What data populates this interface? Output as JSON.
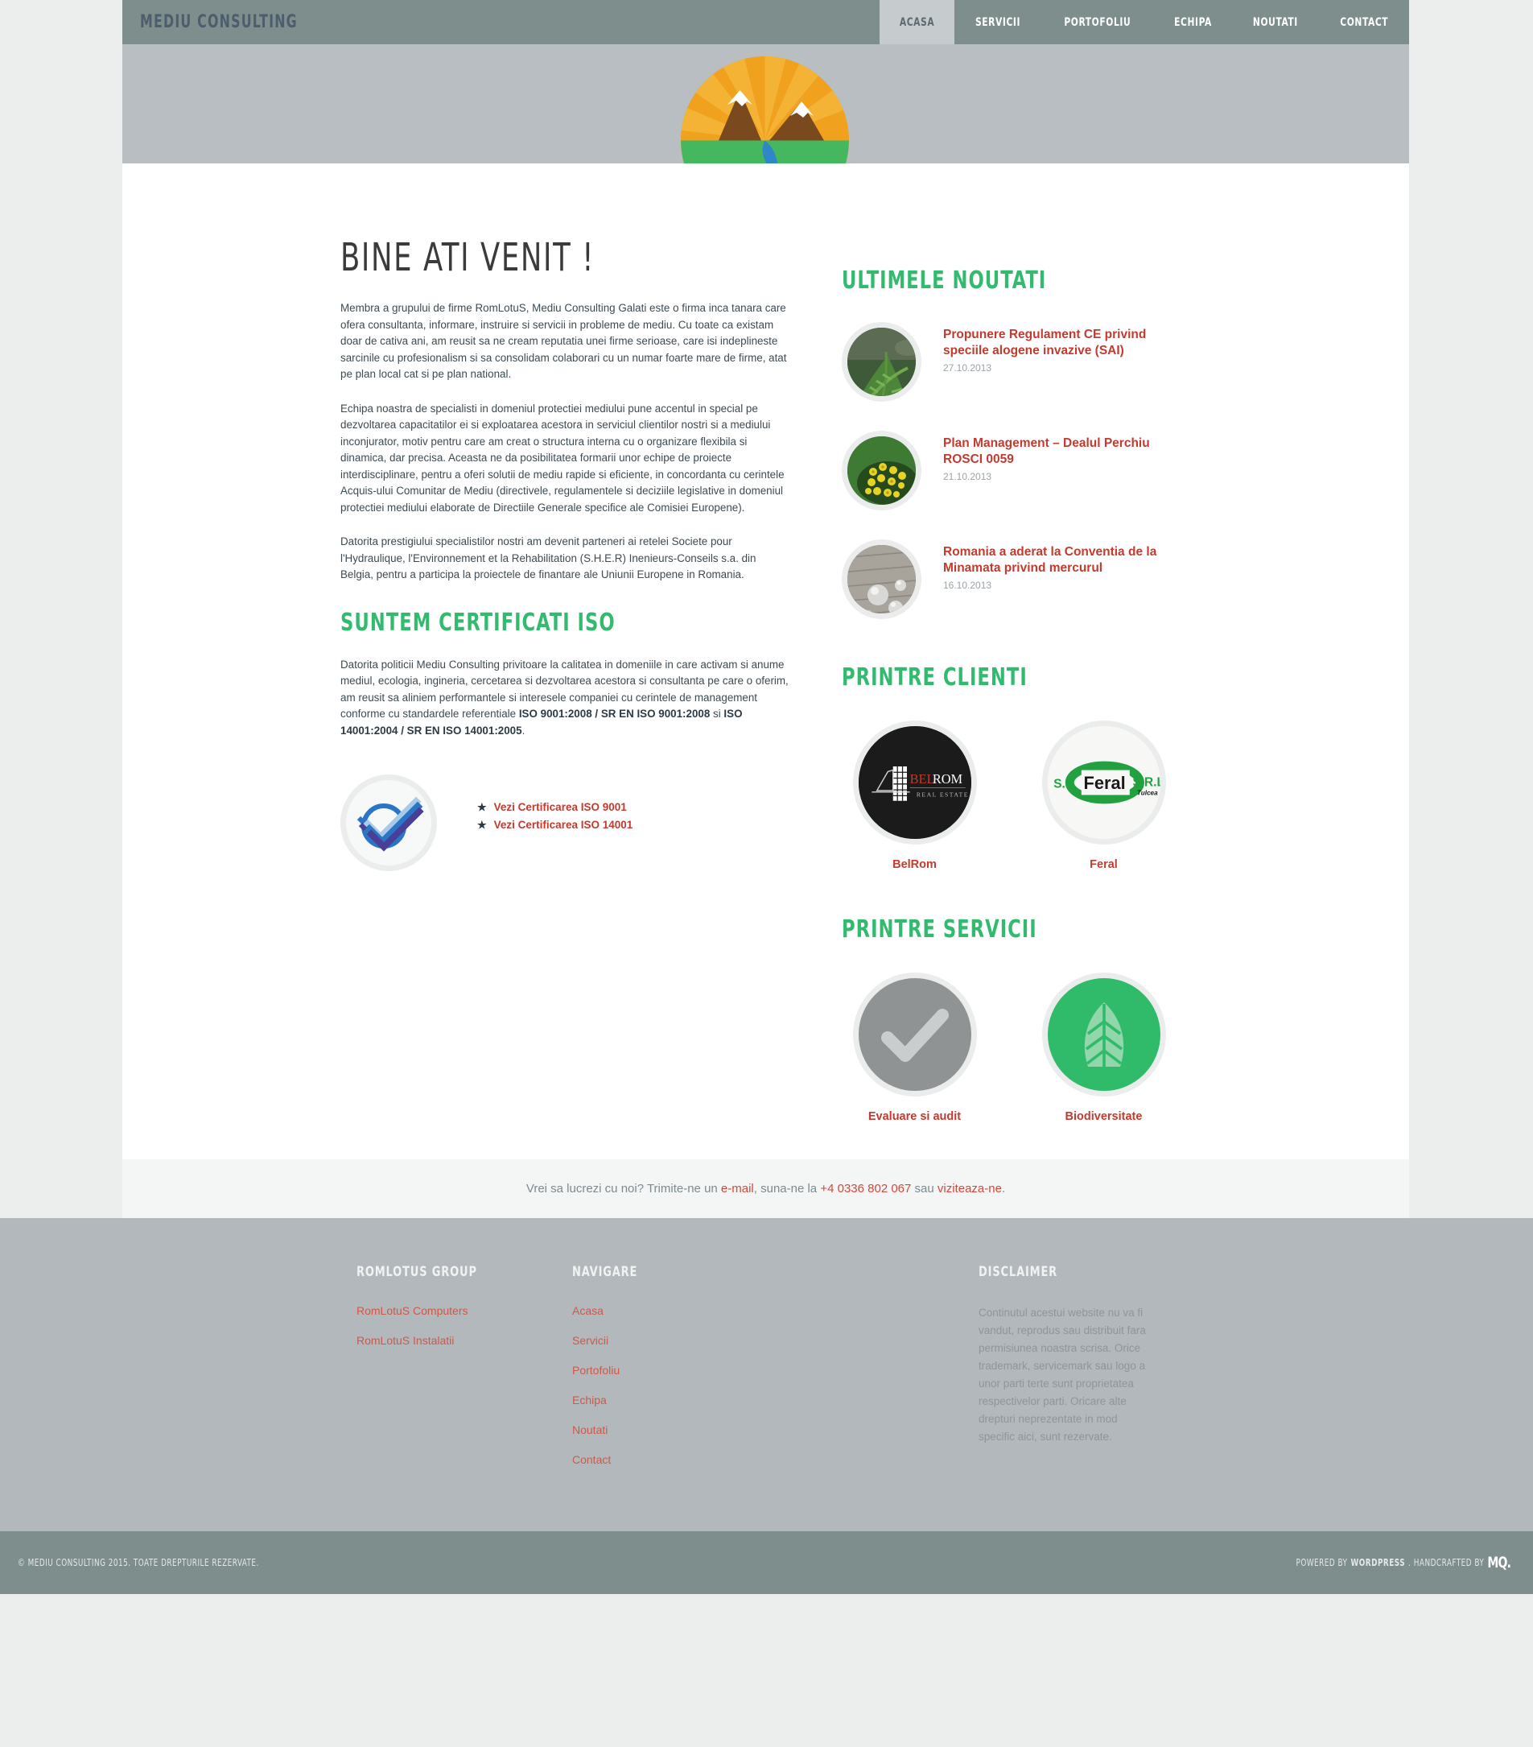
{
  "site": {
    "brand": "MEDIU CONSULTING",
    "logo_icon": "mountain-sun-river-circle-logo"
  },
  "nav": {
    "items": [
      {
        "label": "ACASA",
        "active": true
      },
      {
        "label": "SERVICII",
        "active": false
      },
      {
        "label": "PORTOFOLIU",
        "active": false
      },
      {
        "label": "ECHIPA",
        "active": false
      },
      {
        "label": "NOUTATI",
        "active": false
      },
      {
        "label": "CONTACT",
        "active": false
      }
    ]
  },
  "main": {
    "welcome_heading": "BINE ATI VENIT !",
    "paragraphs": [
      "Membra a grupului de firme RomLotuS, Mediu Consulting Galati este o firma inca tanara care ofera consultanta, informare, instruire si servicii in probleme de mediu. Cu toate ca existam doar de cativa ani, am reusit sa ne cream reputatia unei firme serioase, care isi indeplineste sarcinile cu profesionalism si sa consolidam colaborari cu un numar foarte mare de firme, atat pe plan local cat si pe plan national.",
      "Echipa noastra de specialisti in domeniul protectiei mediului pune accentul in special pe dezvoltarea capacitatilor ei si exploatarea acestora in serviciul clientilor nostri si a mediului inconjurator, motiv pentru care am creat o structura interna cu o organizare flexibila si dinamica, dar precisa. Aceasta ne da posibilitatea formarii unor echipe de proiecte interdisciplinare, pentru a oferi solutii de mediu rapide si eficiente, in concordanta cu cerintele Acquis-ului Comunitar de Mediu (directivele, regulamentele si deciziile legislative in domeniul protectiei mediului elaborate de Directiile Generale specifice ale Comisiei Europene).",
      "Datorita prestigiului specialistilor nostri am devenit parteneri ai retelei Societe pour l'Hydraulique, l'Environnement et la Rehabilitation (S.H.E.R) Inenieurs-Conseils s.a. din Belgia, pentru a participa la proiectele de finantare ale Uniunii Europene in Romania."
    ],
    "iso": {
      "heading": "SUNTEM CERTIFICATI ISO",
      "text_before": "Datorita politicii Mediu Consulting privitoare la calitatea in domeniile in care activam si anume mediul, ecologia, ingineria, cercetarea si dezvoltarea acestora si consultanta pe care o oferim, am reusit sa aliniem performantele si interesele companiei cu cerintele de management conforme cu standardele referentiale ",
      "bold_1": "ISO 9001:2008 / SR EN ISO 9001:2008",
      "text_mid": " si ",
      "bold_2": "ISO 14001:2004 / SR EN ISO 14001:2005",
      "text_after": ".",
      "badge_icon": "iso-check-badge-icon",
      "links": [
        {
          "star": "★",
          "label": "Vezi Certificarea ISO 9001"
        },
        {
          "star": "★",
          "label": "Vezi Certificarea ISO 14001"
        }
      ]
    }
  },
  "sidebar": {
    "news_heading": "ULTIMELE NOUTATI",
    "news": [
      {
        "title": "Propunere Regulament CE privind speciile alogene invazive (SAI)",
        "date": "27.10.2013",
        "thumb_icon": "fern-plant-photo"
      },
      {
        "title": "Plan Management – Dealul Perchiu ROSCI 0059",
        "date": "21.10.2013",
        "thumb_icon": "yellow-flowers-photo"
      },
      {
        "title": "Romania a aderat la Conventia de la Minamata privind mercurul",
        "date": "16.10.2013",
        "thumb_icon": "mercury-droplets-photo"
      }
    ],
    "clients_heading": "PRINTRE CLIENTI",
    "clients": [
      {
        "label": "BelRom",
        "logo_icon": "belrom-real-estate-logo",
        "logo_text_1": "BEL",
        "logo_text_2": "ROM",
        "logo_sub": "REAL ESTATE"
      },
      {
        "label": "Feral",
        "logo_icon": "feral-srl-tulcea-logo",
        "logo_text_1": "S.",
        "logo_text_2": "Feral",
        "logo_text_3": "S.R.L.",
        "logo_sub": "Tulcea"
      }
    ],
    "services_heading": "PRINTRE SERVICII",
    "services": [
      {
        "label": "Evaluare si audit",
        "icon": "checkmark-icon",
        "bg": "#8f9394",
        "fg": "#c9cdcd"
      },
      {
        "label": "Biodiversitate",
        "icon": "leaf-icon",
        "bg": "#2fbb6a",
        "fg": "#92d6ab"
      }
    ]
  },
  "cta": {
    "part1": "Vrei sa lucrezi cu noi? Trimite-ne un ",
    "link_email": "e-mail",
    "part2": ", suna-ne la ",
    "link_phone": "+4 0336 802 067",
    "part3": " sau ",
    "link_visit": "viziteaza-ne",
    "part4": "."
  },
  "footer": {
    "col1": {
      "title": "ROMLOTUS GROUP",
      "links": [
        "RomLotuS Computers",
        "RomLotuS Instalatii"
      ]
    },
    "col2": {
      "title": "NAVIGARE",
      "links": [
        "Acasa",
        "Servicii",
        "Portofoliu",
        "Echipa",
        "Noutati",
        "Contact"
      ]
    },
    "col3": {
      "title": "DISCLAIMER",
      "text": "Continutul acestui website nu va fi vandut, reprodus sau distribuit fara permisiunea noastra scrisa. Orice trademark, servicemark sau logo a unor parti terte sunt proprietatea respectivelor parti. Oricare alte drepturi neprezentate in mod specific aici, sunt rezervate."
    }
  },
  "bottom": {
    "copyright": "© MEDIU CONSULTING 2015. TOATE DREPTURILE REZERVATE.",
    "powered_prefix": "POWERED BY",
    "powered_name": "WORDPRESS",
    "handcrafted_prefix": ". HANDCRAFTED BY",
    "handcrafted_logo": "MQ."
  },
  "colors": {
    "header_bg": "#7e8e8d",
    "hero_bg": "#b8bec1",
    "green_accent": "#32bb6e",
    "red_accent": "#c43a2e",
    "footer_bg": "#b2b8bb",
    "page_bg": "#eceeee"
  }
}
